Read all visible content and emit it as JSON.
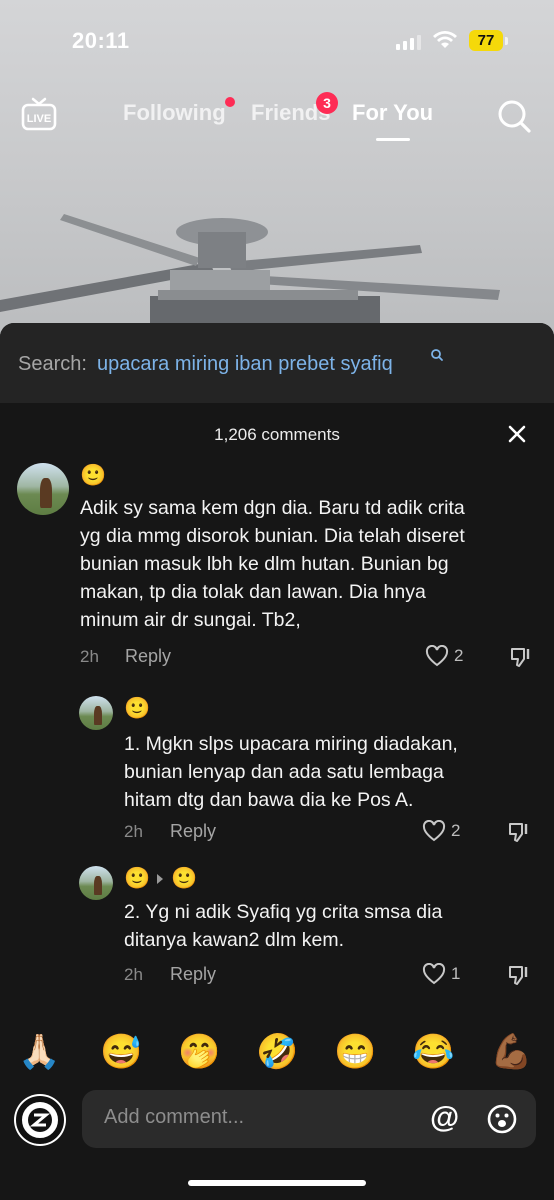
{
  "status_bar": {
    "time": "20:11",
    "battery": "77"
  },
  "top_nav": {
    "live_label": "LIVE",
    "tabs": [
      {
        "label": "Following"
      },
      {
        "label": "Friends",
        "badge": "3"
      },
      {
        "label": "For You"
      }
    ]
  },
  "search": {
    "prefix": "Search:",
    "query": "upacara miring iban prebet syafiq"
  },
  "comments_header": {
    "count": "1,206 comments"
  },
  "comments": [
    {
      "emoji": "🙂",
      "text_lines": [
        "Adik sy sama kem dgn dia. Baru td adik crita",
        "yg dia mmg disorok bunian. Dia telah diseret",
        "bunian masuk lbh ke dlm hutan. Bunian bg",
        "makan, tp dia tolak dan lawan. Dia hnya",
        "minum air dr sungai. Tb2,"
      ],
      "time": "2h",
      "reply_label": "Reply",
      "likes": "2"
    },
    {
      "emoji": "🙂",
      "text_lines": [
        "1. Mgkn slps upacara miring diadakan,",
        "bunian lenyap dan ada satu lembaga",
        "hitam dtg dan bawa dia ke Pos A."
      ],
      "time": "2h",
      "reply_label": "Reply",
      "likes": "2"
    },
    {
      "emoji": "🙂",
      "reply_to_emoji": "🙂",
      "text_lines": [
        "2. Yg ni adik Syafiq yg crita smsa dia",
        "ditanya kawan2 dlm kem."
      ],
      "time": "2h",
      "reply_label": "Reply",
      "likes": "1"
    }
  ],
  "quick_emojis": [
    "🙏🏻",
    "😅",
    "🤭",
    "🤣",
    "😁",
    "😂",
    "💪🏾"
  ],
  "composer": {
    "placeholder": "Add comment...",
    "at_symbol": "@"
  },
  "colors": {
    "accent_red": "#fe2c55",
    "search_query": "#7db3e8",
    "battery": "#f5d90a"
  },
  "icons": [
    "live-icon",
    "search-icon",
    "close-icon",
    "heart-icon",
    "dislike-icon",
    "at-icon",
    "emoji-face-icon"
  ]
}
